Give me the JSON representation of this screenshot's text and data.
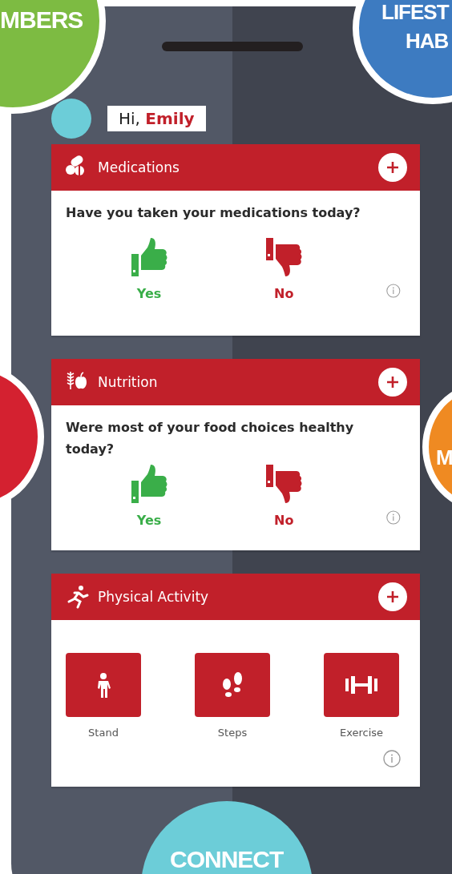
{
  "badges": [
    {
      "lines": [
        "MBERS"
      ],
      "color": "#7dbb42"
    },
    {
      "lines": [
        "LIFEST",
        "HAB"
      ],
      "color": "#3d7bc1"
    },
    {
      "color": "#d42130"
    },
    {
      "lines": [
        "M"
      ],
      "color": "#ef8a22"
    },
    {
      "lines": [
        "CONNECT"
      ],
      "color": "#6ccdd8"
    }
  ],
  "greeting": {
    "hi": "Hi,",
    "name": "Emily"
  },
  "cards": [
    {
      "kind": "question",
      "title": "Medications",
      "question": "Have you taken your medications today?",
      "answers": [
        {
          "kind": "yes",
          "label": "Yes"
        },
        {
          "kind": "no",
          "label": "No"
        }
      ]
    },
    {
      "kind": "question",
      "title": "Nutrition",
      "question": "Were most of your food choices healthy today?",
      "answers": [
        {
          "kind": "yes",
          "label": "Yes"
        },
        {
          "kind": "no",
          "label": "No"
        }
      ]
    },
    {
      "kind": "activity",
      "title": "Physical Activity",
      "activities": [
        {
          "label": "Stand"
        },
        {
          "label": "Steps"
        },
        {
          "label": "Exercise"
        }
      ]
    }
  ]
}
